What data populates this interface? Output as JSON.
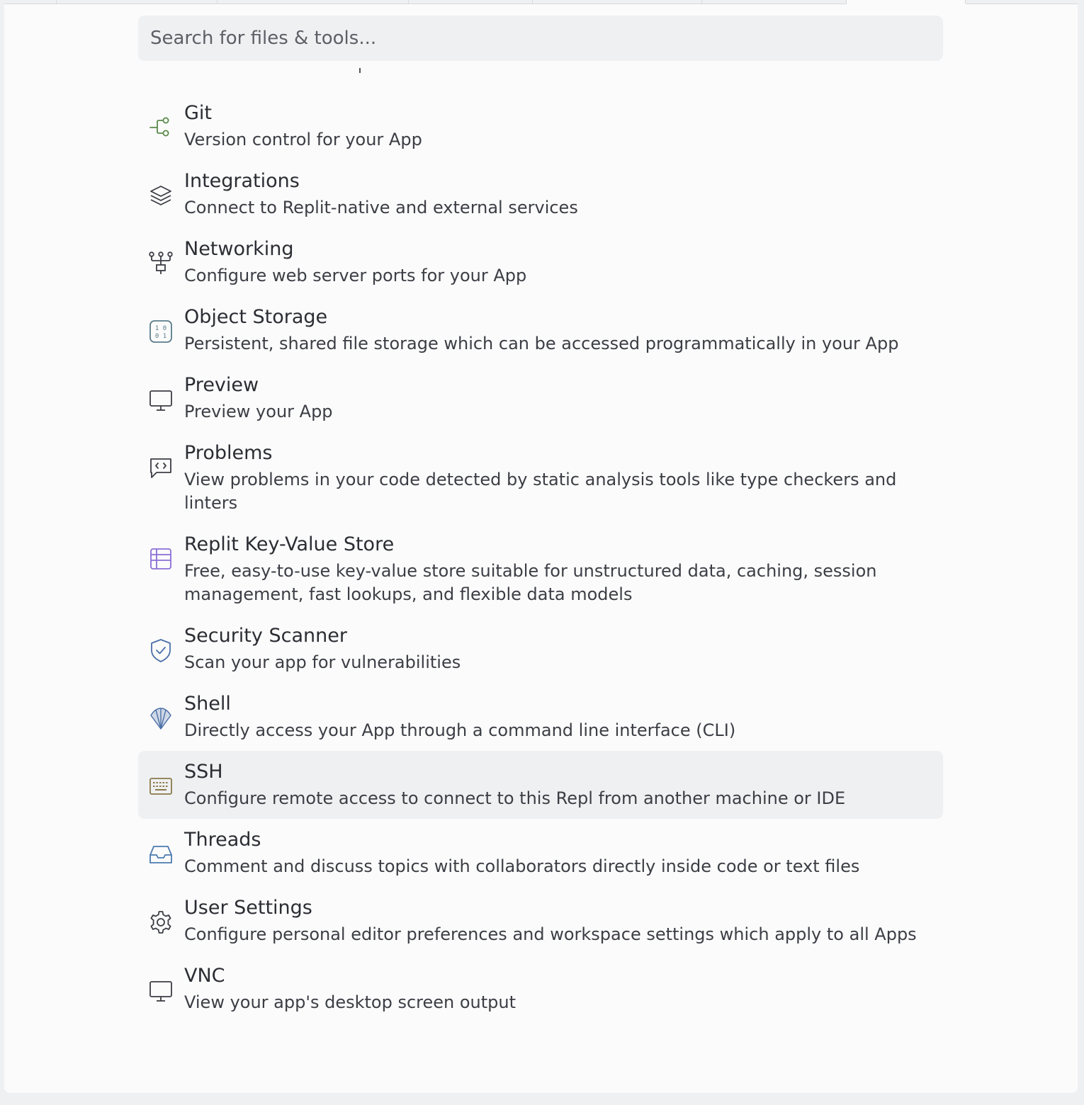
{
  "search": {
    "placeholder": "Search for files & tools...",
    "value": ""
  },
  "items": [
    {
      "key": "git",
      "title": "Git",
      "description": "Version control for your App",
      "icon": "git-branch-icon",
      "color": "#5a8a4a"
    },
    {
      "key": "integrations",
      "title": "Integrations",
      "description": "Connect to Replit-native and external services",
      "icon": "layers-icon",
      "color": "#3c3e45"
    },
    {
      "key": "networking",
      "title": "Networking",
      "description": "Configure web server ports for your App",
      "icon": "network-icon",
      "color": "#3c3e45"
    },
    {
      "key": "object-storage",
      "title": "Object Storage",
      "description": "Persistent, shared file storage which can be accessed programmatically in your App",
      "icon": "binary-box-icon",
      "color": "#5b7c8a"
    },
    {
      "key": "preview",
      "title": "Preview",
      "description": "Preview your App",
      "icon": "monitor-icon",
      "color": "#3c3e45"
    },
    {
      "key": "problems",
      "title": "Problems",
      "description": "View problems in your code detected by static analysis tools like type checkers and linters",
      "icon": "code-message-icon",
      "color": "#3c3e45"
    },
    {
      "key": "kv-store",
      "title": "Replit Key-Value Store",
      "description": "Free, easy-to-use key-value store suitable for unstructured data, caching, session management, fast lookups, and flexible data models",
      "icon": "table-icon",
      "color": "#8a6fd6"
    },
    {
      "key": "security-scanner",
      "title": "Security Scanner",
      "description": "Scan your app for vulnerabilities",
      "icon": "shield-check-icon",
      "color": "#4a6fa8"
    },
    {
      "key": "shell",
      "title": "Shell",
      "description": "Directly access your App through a command line interface (CLI)",
      "icon": "shell-icon",
      "color": "#4a6fa8"
    },
    {
      "key": "ssh",
      "title": "SSH",
      "description": "Configure remote access to connect to this Repl from another machine or IDE",
      "icon": "keyboard-icon",
      "color": "#8a7a4a",
      "active": true
    },
    {
      "key": "threads",
      "title": "Threads",
      "description": "Comment and discuss topics with collaborators directly inside code or text files",
      "icon": "inbox-icon",
      "color": "#4a7ab0"
    },
    {
      "key": "user-settings",
      "title": "User Settings",
      "description": "Configure personal editor preferences and workspace settings which apply to all Apps",
      "icon": "gear-icon",
      "color": "#3c3e45"
    },
    {
      "key": "vnc",
      "title": "VNC",
      "description": "View your app's desktop screen output",
      "icon": "monitor-icon",
      "color": "#3c3e45"
    }
  ]
}
